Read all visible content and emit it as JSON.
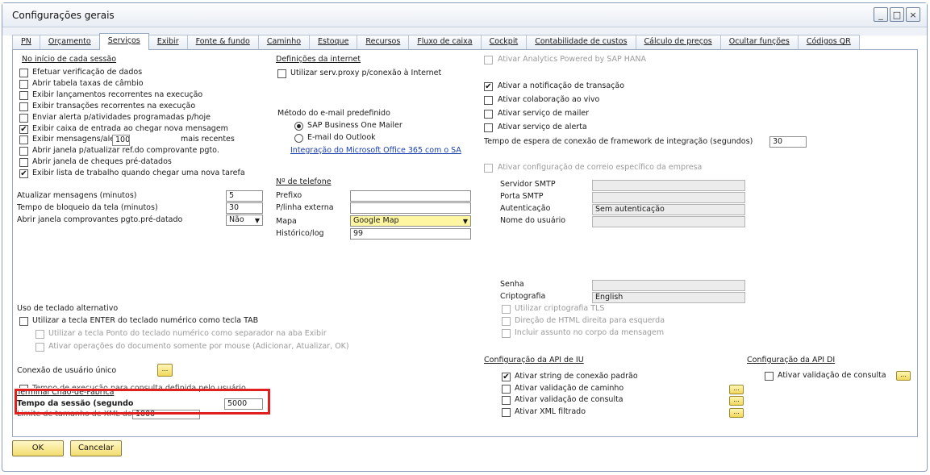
{
  "window": {
    "title": "Configurações gerais",
    "controls": [
      "_",
      "□",
      "×"
    ]
  },
  "tabs": [
    {
      "label": "PN"
    },
    {
      "label": "Orçamento"
    },
    {
      "label": "Serviços"
    },
    {
      "label": "Exibir"
    },
    {
      "label": "Fonte & fundo"
    },
    {
      "label": "Caminho"
    },
    {
      "label": "Estoque"
    },
    {
      "label": "Recursos"
    },
    {
      "label": "Fluxo de caixa"
    },
    {
      "label": "Cockpit"
    },
    {
      "label": "Contabilidade de custos"
    },
    {
      "label": "Cálculo de preços"
    },
    {
      "label": "Ocultar funções"
    },
    {
      "label": "Códigos QR"
    }
  ],
  "active_tab": "Serviços",
  "startup": {
    "header": "No início de cada sessão",
    "items": [
      {
        "label": "Efetuar verificação de dados",
        "checked": false
      },
      {
        "label": "Abrir tabela taxas de câmbio",
        "checked": false
      },
      {
        "label": "Exibir lançamentos recorrentes na execução",
        "checked": false
      },
      {
        "label": "Exibir transações recorrentes na execução",
        "checked": false
      },
      {
        "label": "Enviar alerta p/atividades programadas p/hoje",
        "checked": false
      },
      {
        "label": "Exibir caixa de entrada ao chegar nova mensagem",
        "checked": true
      },
      {
        "label": "Exibir mensagens/aler",
        "checked": false,
        "value": "100",
        "suffix": "mais recentes"
      },
      {
        "label": "Abrir janela p/atualizar ref.do comprovante pgto.",
        "checked": false
      },
      {
        "label": "Abrir janela de cheques pré-datados",
        "checked": false
      },
      {
        "label": "Exibir lista de trabalho quando chegar uma nova tarefa",
        "checked": true
      }
    ]
  },
  "timers": {
    "update_messages_label": "Atualizar mensagens (minutos)",
    "update_messages_value": "5",
    "screen_lock_label": "Tempo de bloqueio da tela (minutos)",
    "screen_lock_value": "30",
    "open_postdated_label": "Abrir janela comprovantes pgto.pré-datado",
    "open_postdated_value": "Não"
  },
  "internet": {
    "header": "Definições da internet",
    "proxy_label": "Utilizar serv.proxy p/conexão à Internet",
    "proxy_checked": false
  },
  "email": {
    "header": "Método do e-mail predefinido",
    "options": [
      {
        "label": "SAP Business One Mailer",
        "selected": true
      },
      {
        "label": "E-mail do Outlook",
        "selected": false
      }
    ],
    "office_link": "Integração do Microsoft Office 365 com o SA"
  },
  "phone": {
    "header": "Nº de telefone",
    "prefix_label": "Prefixo",
    "prefix_value": "",
    "external_label": "P/linha externa",
    "external_value": "",
    "map_label": "Mapa",
    "map_value": "Google Map",
    "history_label": "Histórico/log",
    "history_value": "99"
  },
  "right": {
    "analytics_label": "Ativar Analytics Powered by SAP HANA",
    "analytics_checked": false,
    "notif_label": "Ativar a notificação de transação",
    "notif_checked": true,
    "collab_label": "Ativar colaboração ao vivo",
    "collab_checked": false,
    "mailer_label": "Ativar serviço de mailer",
    "mailer_checked": false,
    "alert_label": "Ativar serviço de alerta",
    "alert_checked": false,
    "framework_label": "Tempo de espera de conexão de framework de integração (segundos)",
    "framework_value": "30",
    "company_mail_label": "Ativar configuração de correio específico da empresa",
    "smtp_server_label": "Servidor SMTP",
    "smtp_server_value": "",
    "smtp_port_label": "Porta SMTP",
    "smtp_port_value": "",
    "auth_label": "Autenticação",
    "auth_value": "Sem autenticação",
    "user_label": "Nome do usuário",
    "user_value": "",
    "password_label": "Senha",
    "password_value": "",
    "crypto_label": "Criptografia",
    "crypto_value": "English",
    "tls_label": "Utilizar criptografia TLS",
    "rtl_label": "Direção de HTML direita para esquerda",
    "subject_label": "Incluir assunto no corpo da mensagem"
  },
  "keyboard": {
    "header": "Uso de teclado alternativo",
    "enter_label": "Utilizar a tecla ENTER do teclado numérico como tecla TAB",
    "dot_label": "Utilizar a tecla Ponto do teclado numérico como separador na aba Exibir",
    "mouse_label": "Ativar operações do documento somente por mouse (Adicionar, Atualizar, OK)"
  },
  "sso": {
    "label": "Conexão de usuário único",
    "button": "..."
  },
  "session": {
    "overlap_text": "Tempo de execução para consulta definida pelo usuário",
    "terminal_label": "Terminal Chão-de-Fábrica",
    "timeout_label": "Tempo da sessão (segundo",
    "timeout_value": "5000",
    "xml_label": "Limite de tamanho de XML do sí",
    "xml_value": "1000"
  },
  "api_ui": {
    "header": "Configuração da API de IU",
    "items": [
      {
        "label": "Ativar string de conexão padrão",
        "checked": true,
        "has_button": false
      },
      {
        "label": "Ativar validação de caminho",
        "checked": false,
        "has_button": true
      },
      {
        "label": "Ativar validação de consulta",
        "checked": false,
        "has_button": true
      },
      {
        "label": "Ativar XML filtrado",
        "checked": false,
        "has_button": true
      }
    ]
  },
  "api_di": {
    "header": "Configuração da API DI",
    "query_label": "Ativar validação de consulta",
    "query_checked": false
  },
  "footer": {
    "ok_label": "OK",
    "cancel_label": "Cancelar"
  },
  "colors": {
    "highlight_box": "#e21f1f",
    "link": "#1a3fb0",
    "button_yellow": "#f2dc6e"
  }
}
